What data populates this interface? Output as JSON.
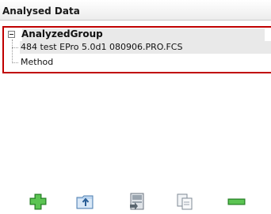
{
  "header": {
    "title": "Analysed Data"
  },
  "tree": {
    "root": {
      "label": "AnalyzedGroup",
      "expanded": true
    },
    "children": [
      {
        "label": "484 test EPro 5.0d1 080906.PRO.FCS"
      },
      {
        "label": "Method"
      }
    ]
  },
  "highlight_color": "#c00000",
  "toolbar": {
    "buttons": [
      {
        "icon": "plus-icon",
        "color": "#3aa537"
      },
      {
        "icon": "folder-export-icon",
        "color": "#6aa0d8"
      },
      {
        "icon": "file-open-icon",
        "color": "#7a8a9a"
      },
      {
        "icon": "copy-icon",
        "color": "#8a9aa8"
      },
      {
        "icon": "minus-icon",
        "color": "#3aa537"
      }
    ]
  }
}
